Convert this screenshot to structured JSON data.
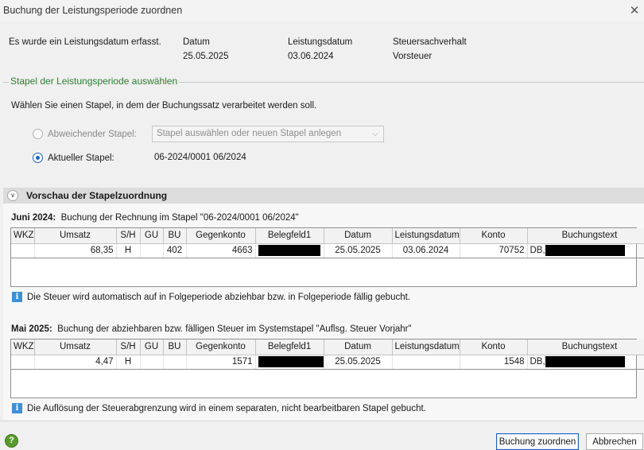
{
  "window": {
    "title": "Buchung der Leistungsperiode zuordnen",
    "close_glyph": "✕"
  },
  "info": {
    "message": "Es wurde ein Leistungsdatum erfasst.",
    "datum_label": "Datum",
    "datum_value": "25.05.2025",
    "leistungsdatum_label": "Leistungsdatum",
    "leistungsdatum_value": "03.06.2024",
    "steuer_label": "Steuersachverhalt",
    "steuer_value": "Vorsteuer"
  },
  "stapel": {
    "group_title": "Stapel der Leistungsperiode auswählen",
    "instruction": "Wählen Sie einen Stapel, in dem der Buchungssatz verarbeitet werden soll.",
    "option_abweichend": "Abweichender Stapel:",
    "combo_placeholder": "Stapel auswählen oder neuen Stapel anlegen",
    "option_aktuell": "Aktueller Stapel:",
    "aktuell_value": "06-2024/0001 06/2024",
    "selected": "aktuell"
  },
  "preview": {
    "title": "Vorschau der Stapelzuordnung",
    "columns": [
      "WKZ",
      "Umsatz",
      "S/H",
      "GU",
      "BU",
      "Gegenkonto",
      "Belegfeld1",
      "Datum",
      "Leistungsdatum",
      "Konto",
      "Buchungstext"
    ],
    "block1": {
      "period": "Juni 2024:",
      "caption": "Buchung der Rechnung im Stapel \"06-2024/0001 06/2024\"",
      "row": [
        "",
        "68,35",
        "H",
        "",
        "402",
        "4663",
        "",
        "25.05.2025",
        "03.06.2024",
        "70752",
        "DB,"
      ],
      "note": "Die Steuer wird automatisch auf in Folgeperiode abziehbar bzw. in Folgeperiode fällig gebucht."
    },
    "block2": {
      "period": "Mai 2025:",
      "caption": "Buchung der abziehbaren bzw. fälligen Steuer im Systemstapel \"Auflsg. Steuer Vorjahr\"",
      "row": [
        "",
        "4,47",
        "H",
        "",
        "",
        "1571",
        "",
        "25.05.2025",
        "",
        "1548",
        "DB,"
      ],
      "note": "Die Auflösung der Steuerabgrenzung wird in einem separaten, nicht bearbeitbaren Stapel gebucht."
    }
  },
  "footer": {
    "help_glyph": "?",
    "assign_label": "Buchung zuordnen",
    "cancel_label": "Abbrechen"
  },
  "icons": {
    "info": "info-icon",
    "help": "help-icon",
    "toggle": "chevron-down-icon"
  },
  "colors": {
    "group_title": "#2e7d32",
    "accent": "#1565c0",
    "info_icon": "#3d8fd4"
  }
}
